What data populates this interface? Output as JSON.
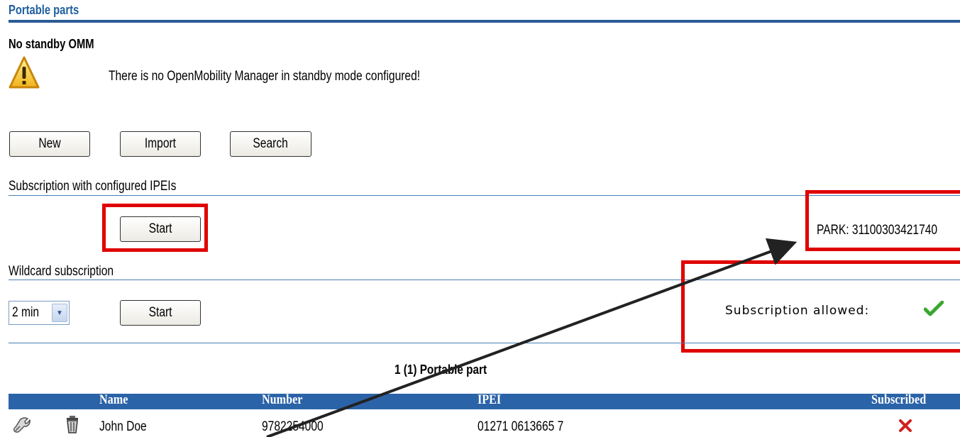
{
  "page": {
    "title": "Portable parts"
  },
  "standby": {
    "heading": "No standby OMM",
    "message": "There is no OpenMobility Manager in standby mode configured!",
    "icon": "warning-icon"
  },
  "toolbar": {
    "new_label": "New",
    "import_label": "Import",
    "search_label": "Search"
  },
  "configured_subscription": {
    "heading": "Subscription with configured IPEIs",
    "start_label": "Start",
    "park_label": "PARK: 31100303421740"
  },
  "wildcard_subscription": {
    "heading": "Wildcard subscription",
    "duration_selected": "2 min",
    "start_label": "Start",
    "status_label": "Subscription allowed:",
    "status_icon": "check-icon"
  },
  "list": {
    "count_label": "1 (1) Portable part",
    "columns": {
      "name": "Name",
      "number": "Number",
      "ipei": "IPEI",
      "subscribed": "Subscribed"
    },
    "rows": [
      {
        "name": "John Doe",
        "number": "9782254000",
        "ipei": "01271 0613665 7",
        "subscribed_icon": "cross-icon"
      }
    ]
  },
  "colors": {
    "accent": "#2b63a8",
    "highlight": "#e00000",
    "ok": "#3aa72f",
    "error": "#d02020"
  }
}
